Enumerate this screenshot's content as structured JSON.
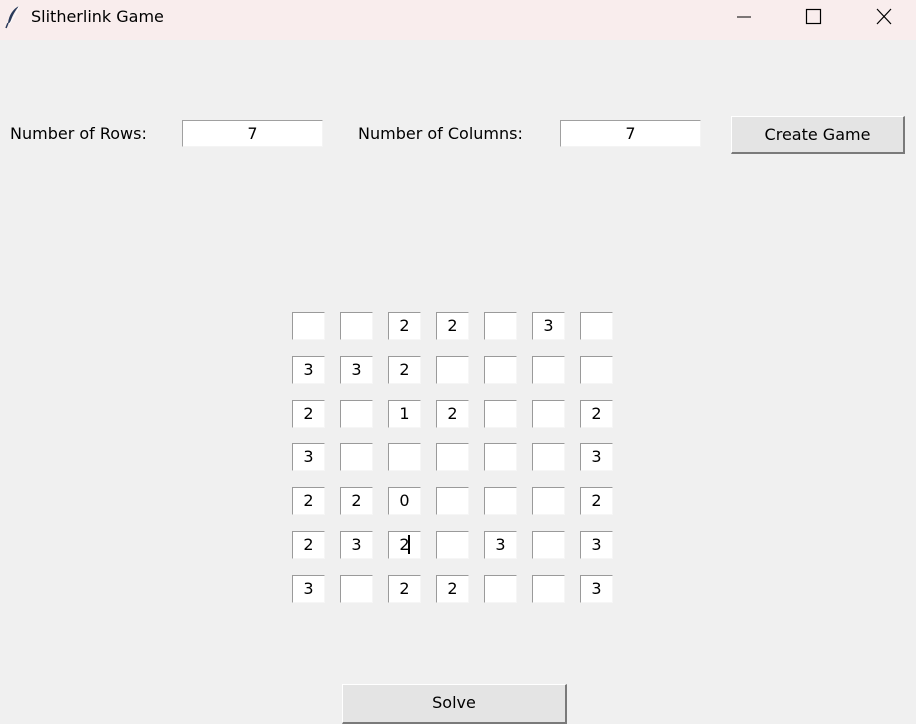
{
  "window": {
    "title": "Slitherlink Game",
    "app_icon": "feather-icon"
  },
  "controls": {
    "rows_label": "Number of Rows:",
    "rows_value": "7",
    "cols_label": "Number of Columns:",
    "cols_value": "7",
    "create_button": "Create Game",
    "solve_button": "Solve"
  },
  "grid": {
    "focused_cell": [
      5,
      2
    ],
    "cells": [
      [
        "",
        "",
        "2",
        "2",
        "",
        "3",
        ""
      ],
      [
        "3",
        "3",
        "2",
        "",
        "",
        "",
        ""
      ],
      [
        "2",
        "",
        "1",
        "2",
        "",
        "",
        "2"
      ],
      [
        "3",
        "",
        "",
        "",
        "",
        "",
        "3"
      ],
      [
        "2",
        "2",
        "0",
        "",
        "",
        "",
        "2"
      ],
      [
        "2",
        "3",
        "2",
        "",
        "3",
        "",
        "3"
      ],
      [
        "3",
        "",
        "2",
        "2",
        "",
        "",
        "3"
      ]
    ]
  }
}
